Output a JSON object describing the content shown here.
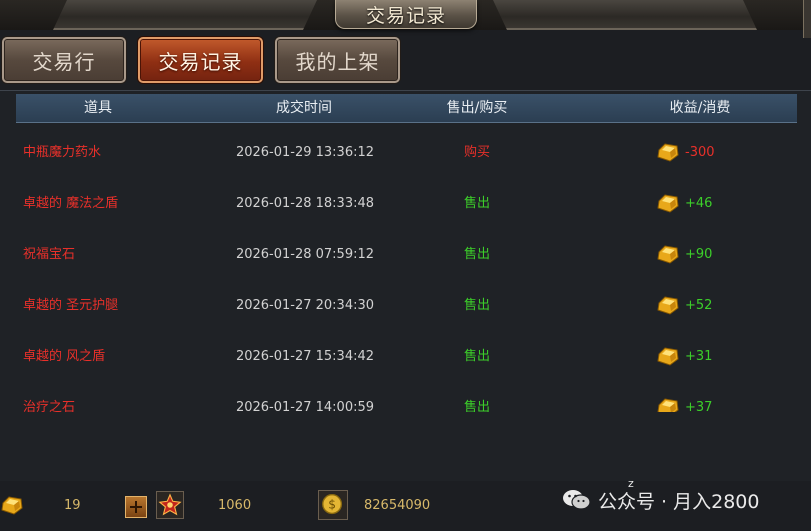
{
  "title": "交易记录",
  "tabs": [
    {
      "label": "交易行",
      "active": false
    },
    {
      "label": "交易记录",
      "active": true
    },
    {
      "label": "我的上架",
      "active": false
    }
  ],
  "table": {
    "headers": [
      "道具",
      "成交时间",
      "售出/购买",
      "收益/消费"
    ],
    "rows": [
      {
        "item": "中瓶魔力药水",
        "time": "2026-01-29 13:36:12",
        "type": "购买",
        "amount": "-300"
      },
      {
        "item": "卓越的 魔法之盾",
        "time": "2026-01-28 18:33:48",
        "type": "售出",
        "amount": "+46"
      },
      {
        "item": "祝福宝石",
        "time": "2026-01-28 07:59:12",
        "type": "售出",
        "amount": "+90"
      },
      {
        "item": "卓越的 圣元护腿",
        "time": "2026-01-27 20:34:30",
        "type": "售出",
        "amount": "+52"
      },
      {
        "item": "卓越的 风之盾",
        "time": "2026-01-27 15:34:42",
        "type": "售出",
        "amount": "+31"
      },
      {
        "item": "治疗之石",
        "time": "2026-01-27 14:00:59",
        "type": "售出",
        "amount": "+37"
      }
    ]
  },
  "currency": {
    "gold_ingot": "19",
    "jewel": "1060",
    "zen": "82654090"
  },
  "watermark": {
    "text": "公众号 · 月入2800",
    "zz": "z"
  },
  "colors": {
    "buy": "#e8302a",
    "sell": "#3ccf2a",
    "item_name": "#e8302a",
    "header_bg": "#2f4459",
    "active_tab": "#8f2f13"
  },
  "icons": {
    "amount": "gold-ingot-icon",
    "bottom": [
      "gold-ingot-icon",
      "add-icon",
      "jewel-icon",
      "zen-coin-icon"
    ]
  }
}
